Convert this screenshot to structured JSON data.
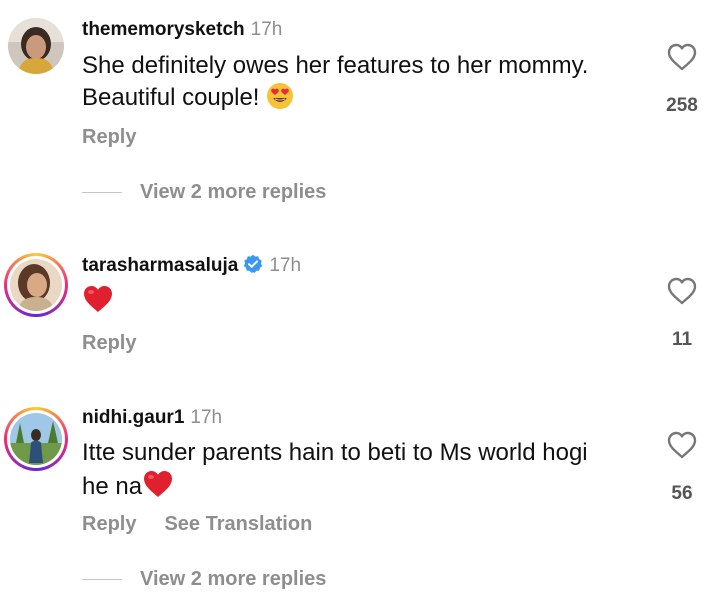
{
  "comments": [
    {
      "username": "thememorysketch",
      "time": "17h",
      "verified": false,
      "text": "She definitely owes her features to her mommy. Beautiful couple!",
      "emoji": "heart-eyes",
      "likes": "258",
      "reply_label": "Reply",
      "view_replies": "View 2 more replies"
    },
    {
      "username": "tarasharmasaluja",
      "time": "17h",
      "verified": true,
      "text": "",
      "emoji": "red-heart",
      "likes": "11",
      "reply_label": "Reply"
    },
    {
      "username": "nidhi.gaur1",
      "time": "17h",
      "verified": false,
      "text": "Itte sunder parents hain to beti to Ms world hogi he na",
      "emoji": "red-heart",
      "likes": "56",
      "reply_label": "Reply",
      "translate_label": "See Translation",
      "view_replies": "View 2 more replies"
    }
  ],
  "colors": {
    "secondary_text": "#8e8e8e",
    "verified_blue": "#3897f0",
    "heart_red": "#e0202e"
  }
}
